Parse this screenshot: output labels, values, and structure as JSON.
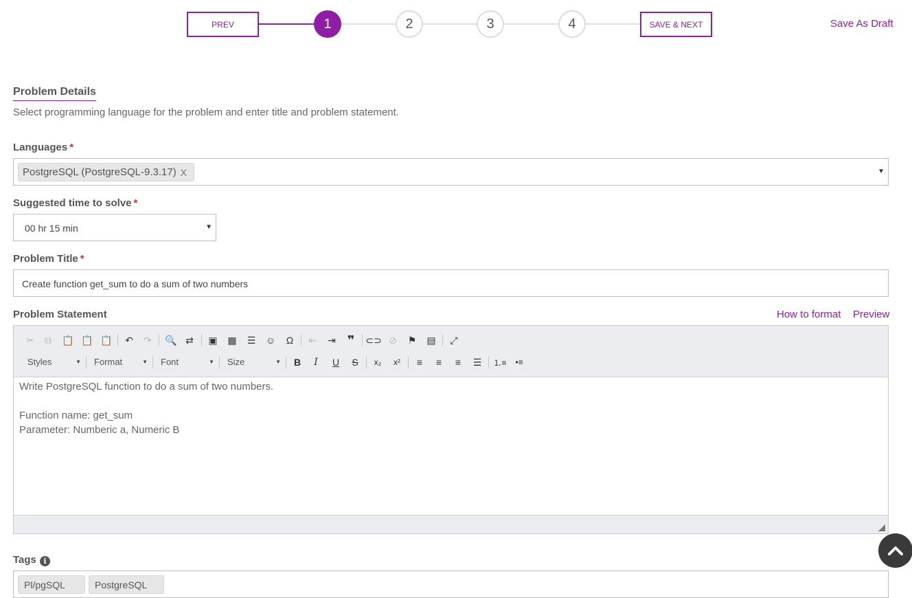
{
  "stepper": {
    "prev_label": "PREV",
    "steps": [
      "1",
      "2",
      "3",
      "4"
    ],
    "active_step": 1,
    "next_label": "SAVE & NEXT",
    "draft_label": "Save As Draft"
  },
  "section": {
    "title": "Problem Details",
    "description": "Select programming language for the problem and enter title and problem statement."
  },
  "languages": {
    "label": "Languages",
    "required_mark": "*",
    "selected": [
      "PostgreSQL (PostgreSQL-9.3.17)"
    ],
    "remove_glyph": "X"
  },
  "time": {
    "label": "Suggested time to solve",
    "required_mark": "*",
    "value": "00 hr 15 min"
  },
  "title_field": {
    "label": "Problem Title",
    "required_mark": "*",
    "value": "Create function get_sum to do a sum of two numbers"
  },
  "statement": {
    "label": "Problem Statement",
    "how_to_format": "How to format",
    "preview": "Preview",
    "combos": [
      "Styles",
      "Format",
      "Font",
      "Size"
    ],
    "body_lines": [
      "Write PostgreSQL function to do a sum of two numbers.",
      "",
      "Function name: get_sum",
      "Parameter: Numberic a, Numeric B"
    ]
  },
  "tags": {
    "label": "Tags",
    "items": [
      "Pl/pgSQL",
      "PostgreSQL"
    ]
  },
  "colors": {
    "accent": "#8f1da5",
    "required": "#c0392b"
  }
}
